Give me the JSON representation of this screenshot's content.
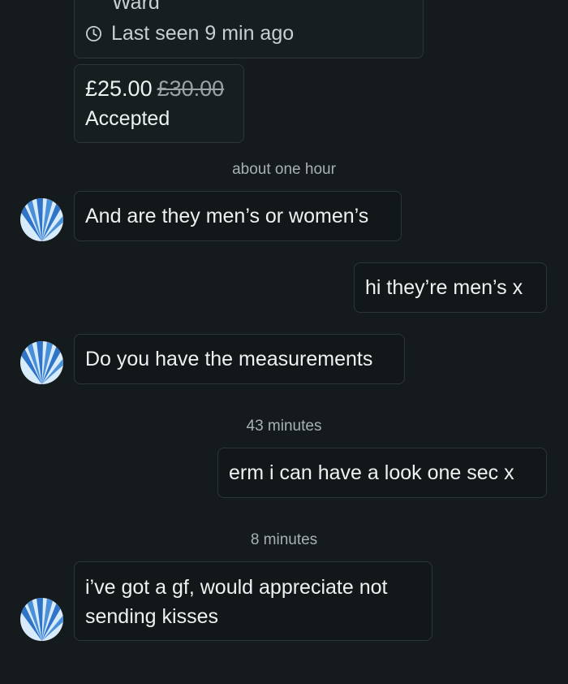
{
  "profile": {
    "name_partial": "Ward",
    "last_seen": "Last seen 9 min ago"
  },
  "offer": {
    "price": "£25.00",
    "original_price": "£30.00",
    "status": "Accepted"
  },
  "conversation": {
    "timestamp_1": "about one hour",
    "msg_1": "And are they men’s or women’s",
    "msg_2": "hi they’re men’s x",
    "msg_3": "Do you have the measurements",
    "timestamp_2": "43 minutes",
    "msg_4": "erm i can have a look one sec x",
    "timestamp_3": "8 minutes",
    "msg_5": "i’ve got a gf, would appreciate not sending kisses"
  },
  "colors": {
    "background": "#151b1d",
    "bubble_border": "#2c3538",
    "text": "#eef1f2",
    "timestamp": "#a9b0b3",
    "avatar_blue": "#4a90d9"
  },
  "icons": {
    "clock": "clock-icon",
    "avatar": "seller-avatar-shell"
  }
}
